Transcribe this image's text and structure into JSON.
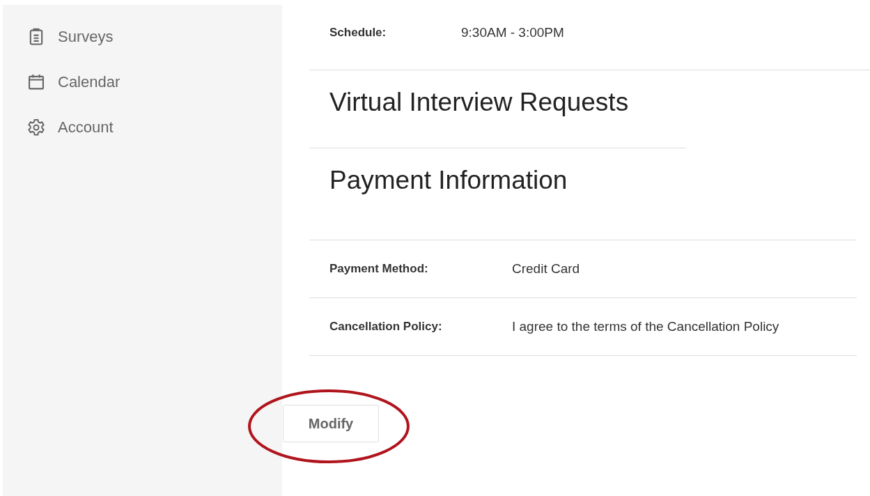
{
  "sidebar": {
    "items": [
      {
        "kind": "clipboard",
        "label": "Surveys"
      },
      {
        "kind": "calendar",
        "label": "Calendar"
      },
      {
        "kind": "gear",
        "label": "Account"
      }
    ]
  },
  "schedule": {
    "label": "Schedule:",
    "value": "9:30AM - 3:00PM"
  },
  "sections": [
    {
      "title": "Virtual Interview Requests"
    },
    {
      "title": "Payment Information"
    }
  ],
  "payment_rows": [
    {
      "label": "Payment Method:",
      "value": "Credit Card"
    },
    {
      "label": "Cancellation Policy:",
      "value": "I agree to the terms of the Cancellation Policy"
    }
  ],
  "button": {
    "label": "Modify"
  }
}
